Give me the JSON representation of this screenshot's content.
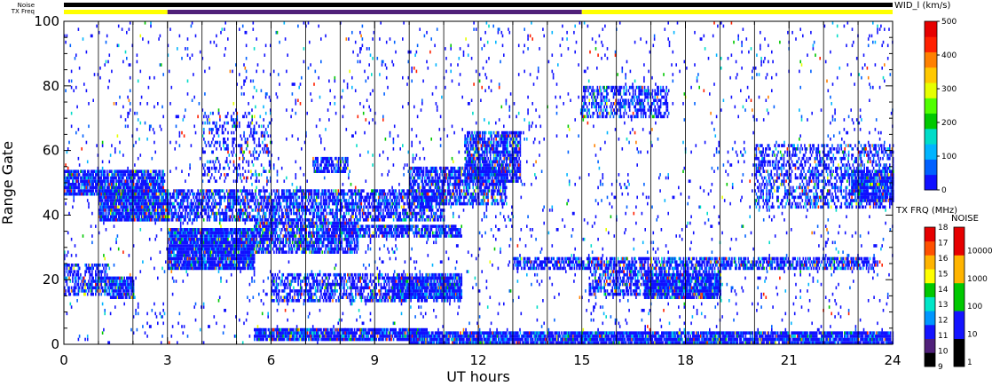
{
  "chart_data": {
    "type": "heatmap",
    "xlabel": "UT hours",
    "ylabel": "Range Gate",
    "xlim": [
      0,
      24
    ],
    "ylim": [
      0,
      100
    ],
    "x_ticks": [
      0,
      3,
      6,
      9,
      12,
      15,
      18,
      21,
      24
    ],
    "y_ticks": [
      0,
      20,
      40,
      60,
      80,
      100
    ],
    "status_labels": [
      "Noise",
      "TX Freq"
    ],
    "status_bars": {
      "noise": [
        {
          "from": 0,
          "to": 24,
          "color": "#000000"
        }
      ],
      "tx_freq": [
        {
          "from": 0,
          "to": 3.0,
          "color": "#ffff00"
        },
        {
          "from": 3.0,
          "to": 15.0,
          "color": "#50207a"
        },
        {
          "from": 15.0,
          "to": 24,
          "color": "#ffff00"
        }
      ]
    },
    "colorbars": {
      "width": {
        "title": "WID_l (km/s)",
        "ticks": [
          0,
          100,
          200,
          300,
          400,
          500
        ],
        "colors": [
          "#1010ff",
          "#0060ff",
          "#00b4ff",
          "#00dcc8",
          "#00c800",
          "#50ff00",
          "#e6ff00",
          "#ffc800",
          "#ff8000",
          "#ff2000",
          "#e60000"
        ]
      },
      "tx_freq": {
        "title": "TX FRQ (MHz)",
        "ticks": [
          9,
          10,
          11,
          12,
          13,
          14,
          15,
          16,
          17,
          18
        ],
        "colors": [
          "#000000",
          "#50207a",
          "#1414ff",
          "#0096ff",
          "#00e6c8",
          "#00c800",
          "#ffff00",
          "#ffb400",
          "#ff5000",
          "#e60000"
        ]
      },
      "noise": {
        "title": "NOISE",
        "ticks": [
          "1",
          "10",
          "100",
          "1000",
          "10000"
        ],
        "colors": [
          "#000000",
          "#1414ff",
          "#00c800",
          "#ffb400",
          "#e60000"
        ]
      }
    },
    "scatter_regions": [
      {
        "t0": 0.0,
        "t1": 2.9,
        "g0": 46,
        "g1": 54,
        "density": 0.85
      },
      {
        "t0": 1.0,
        "t1": 3.0,
        "g0": 38,
        "g1": 48,
        "density": 0.9
      },
      {
        "t0": 0.0,
        "t1": 1.3,
        "g0": 15,
        "g1": 25,
        "density": 0.6
      },
      {
        "t0": 1.3,
        "t1": 2.0,
        "g0": 14,
        "g1": 21,
        "density": 0.9
      },
      {
        "t0": 3.0,
        "t1": 5.5,
        "g0": 23,
        "g1": 36,
        "density": 0.95
      },
      {
        "t0": 5.5,
        "t1": 8.5,
        "g0": 28,
        "g1": 38,
        "density": 0.75
      },
      {
        "t0": 3.0,
        "t1": 11.0,
        "g0": 38,
        "g1": 48,
        "density": 0.65
      },
      {
        "t0": 8.5,
        "t1": 11.5,
        "g0": 33,
        "g1": 37,
        "density": 0.75
      },
      {
        "t0": 10.0,
        "t1": 12.8,
        "g0": 43,
        "g1": 55,
        "density": 0.7
      },
      {
        "t0": 11.6,
        "t1": 13.2,
        "g0": 50,
        "g1": 66,
        "density": 0.75
      },
      {
        "t0": 6.0,
        "t1": 11.5,
        "g0": 13,
        "g1": 22,
        "density": 0.55
      },
      {
        "t0": 9.5,
        "t1": 11.5,
        "g0": 14,
        "g1": 21,
        "density": 0.85
      },
      {
        "t0": 5.5,
        "t1": 10.5,
        "g0": 1,
        "g1": 5,
        "density": 0.9
      },
      {
        "t0": 10.0,
        "t1": 24.0,
        "g0": 0,
        "g1": 4,
        "density": 0.9
      },
      {
        "t0": 13.0,
        "t1": 23.5,
        "g0": 23,
        "g1": 27,
        "density": 0.65
      },
      {
        "t0": 15.2,
        "t1": 19.0,
        "g0": 15,
        "g1": 23,
        "density": 0.6
      },
      {
        "t0": 16.8,
        "t1": 19.0,
        "g0": 14,
        "g1": 22,
        "density": 0.8
      },
      {
        "t0": 15.0,
        "t1": 17.5,
        "g0": 70,
        "g1": 80,
        "density": 0.5
      },
      {
        "t0": 20.0,
        "t1": 24.0,
        "g0": 42,
        "g1": 62,
        "density": 0.45
      },
      {
        "t0": 22.8,
        "t1": 24.0,
        "g0": 44,
        "g1": 54,
        "density": 0.8
      },
      {
        "t0": 7.2,
        "t1": 8.2,
        "g0": 53,
        "g1": 58,
        "density": 0.7
      },
      {
        "t0": 4.0,
        "t1": 6.0,
        "g0": 50,
        "g1": 72,
        "density": 0.25
      },
      {
        "t0": 0.0,
        "t1": 24.0,
        "g0": 0,
        "g1": 100,
        "density": 0.03
      }
    ]
  }
}
